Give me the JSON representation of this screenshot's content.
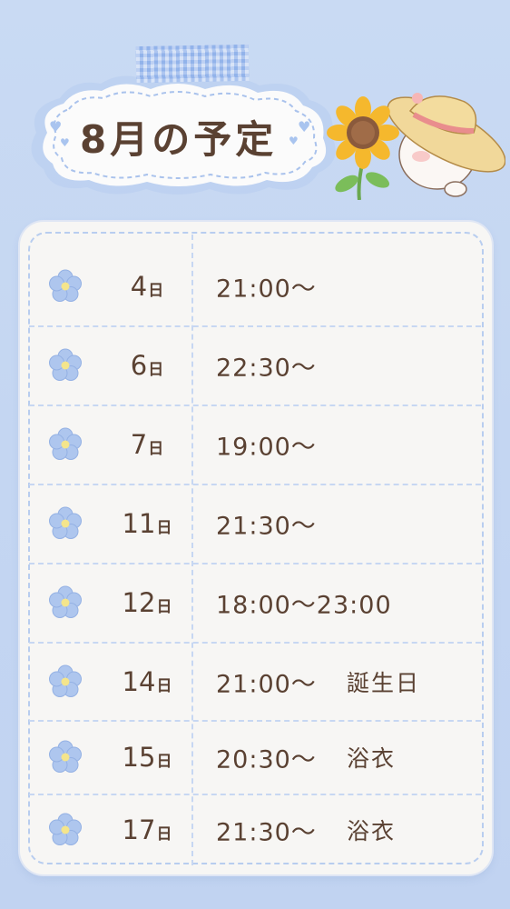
{
  "title": "8月の予定",
  "day_unit": "日",
  "schedule": [
    {
      "day": "4",
      "time": "21:00〜",
      "note": ""
    },
    {
      "day": "6",
      "time": "22:30〜",
      "note": ""
    },
    {
      "day": "7",
      "time": "19:00〜",
      "note": ""
    },
    {
      "day": "11",
      "time": "21:30〜",
      "note": ""
    },
    {
      "day": "12",
      "time": "18:00〜23:00",
      "note": ""
    },
    {
      "day": "14",
      "time": "21:00〜",
      "note": "誕生日"
    },
    {
      "day": "15",
      "time": "20:30〜",
      "note": "浴衣"
    },
    {
      "day": "17",
      "time": "21:30〜",
      "note": "浴衣"
    }
  ],
  "colors": {
    "background": "#c4d6f2",
    "card": "#f7f6f4",
    "text": "#5a4132",
    "flower": "#a9c2ec",
    "accent": "#f2b329"
  },
  "icons": [
    "blue-flower-icon",
    "sunflower-icon",
    "cat-with-straw-hat-icon",
    "heart-icon"
  ]
}
